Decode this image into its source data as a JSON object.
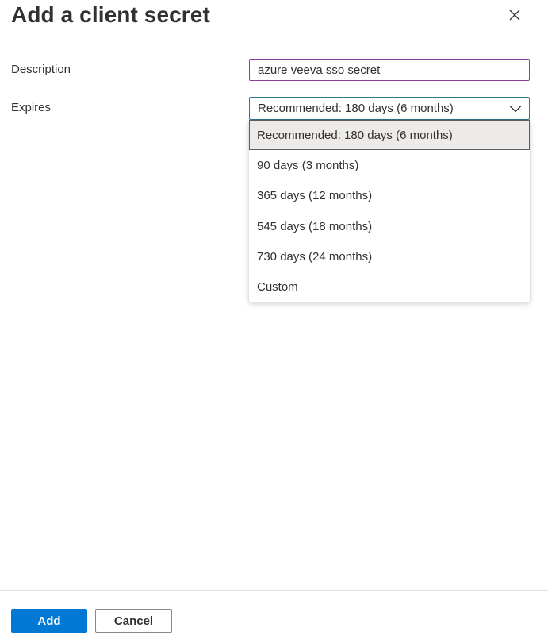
{
  "panel": {
    "title": "Add a client secret",
    "close_icon": "close-icon"
  },
  "form": {
    "description": {
      "label": "Description",
      "value": "azure veeva sso secret"
    },
    "expires": {
      "label": "Expires",
      "selected": "Recommended: 180 days (6 months)",
      "chevron_icon": "chevron-down-icon",
      "options": [
        "Recommended: 180 days (6 months)",
        "90 days (3 months)",
        "365 days (12 months)",
        "545 days (18 months)",
        "730 days (24 months)",
        "Custom"
      ]
    }
  },
  "footer": {
    "add_label": "Add",
    "cancel_label": "Cancel"
  },
  "colors": {
    "primary": "#0078d4",
    "input_border_active": "#8a3fa0",
    "select_border_focus": "#2b7b8c",
    "selected_option_bg": "#edebe9"
  }
}
